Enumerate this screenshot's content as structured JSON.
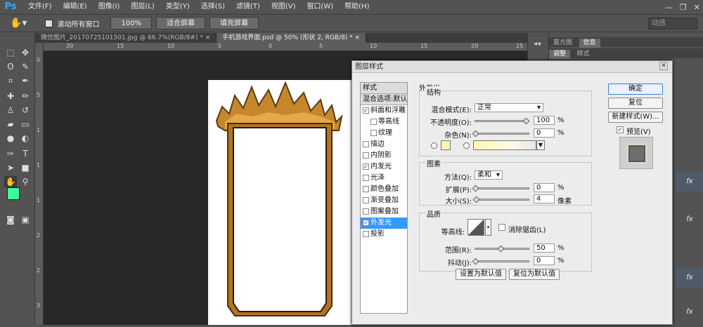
{
  "app": {
    "logo": "Ps"
  },
  "menu": [
    "文件(F)",
    "编辑(E)",
    "图像(I)",
    "图层(L)",
    "类型(Y)",
    "选择(S)",
    "滤镜(T)",
    "视图(V)",
    "窗口(W)",
    "帮助(H)"
  ],
  "window_controls": {
    "minimize": "—",
    "restore": "❐",
    "close": "✕"
  },
  "options_bar": {
    "scroll_all_label": "滚动所有窗口",
    "zoom_100": "100%",
    "fit_screen": "适合屏幕",
    "fill_screen": "填充屏幕",
    "workspace": "动感"
  },
  "tabs": [
    {
      "label": "微信图片_20170725101501.jpg @ 66.7%(RGB/8#) *  ×"
    },
    {
      "label": "手机游戏界面.psd @ 50% (形状 2, RGB/8) *  ×"
    }
  ],
  "ruler_top_ticks": [
    "20",
    "15",
    "10",
    "5",
    "0",
    "5",
    "10",
    "15",
    "20",
    "25"
  ],
  "ruler_left_ticks": [
    "0",
    "5",
    "1",
    "1",
    "1",
    "2",
    "2",
    "3"
  ],
  "right_panel": {
    "tabs_top": [
      "直方图",
      "信息"
    ],
    "tabs_bottom": [
      "调整",
      "样式"
    ],
    "fx_label": "fx"
  },
  "dialog": {
    "title": "图层样式",
    "close": "✕",
    "style_list": [
      {
        "label": "样式",
        "kind": "hdr"
      },
      {
        "label": "混合选项:默认",
        "kind": "hdr"
      },
      {
        "label": "斜面和浮雕",
        "checked": true
      },
      {
        "label": "等高线",
        "checked": false,
        "indent": true
      },
      {
        "label": "纹理",
        "checked": false,
        "indent": true
      },
      {
        "label": "描边",
        "checked": false
      },
      {
        "label": "内阴影",
        "checked": false
      },
      {
        "label": "内发光",
        "checked": true
      },
      {
        "label": "光泽",
        "checked": false
      },
      {
        "label": "颜色叠加",
        "checked": false
      },
      {
        "label": "渐变叠加",
        "checked": false
      },
      {
        "label": "图案叠加",
        "checked": false
      },
      {
        "label": "外发光",
        "checked": true,
        "selected": true
      },
      {
        "label": "投影",
        "checked": false
      }
    ],
    "section_title": "外发光",
    "structure": {
      "title": "结构",
      "blend_label": "混合模式(E):",
      "blend_value": "正常",
      "opacity_label": "不透明度(O):",
      "opacity_value": "100",
      "opacity_unit": "%",
      "opacity_fraction": 1.0,
      "noise_label": "杂色(N):",
      "noise_value": "0",
      "noise_unit": "%",
      "noise_fraction": 0.0,
      "color_swatch": "#fff5b0"
    },
    "elements": {
      "title": "图素",
      "technique_label": "方法(Q):",
      "technique_value": "柔和",
      "spread_label": "扩展(P):",
      "spread_value": "0",
      "spread_unit": "%",
      "spread_fraction": 0.0,
      "size_label": "大小(S):",
      "size_value": "4",
      "size_unit": "像素",
      "size_fraction": 0.02
    },
    "quality": {
      "title": "品质",
      "contour_label": "等高线:",
      "antialias_label": "消除锯齿(L)",
      "range_label": "范围(R):",
      "range_value": "50",
      "range_unit": "%",
      "range_fraction": 0.5,
      "jitter_label": "抖动(J):",
      "jitter_value": "0",
      "jitter_unit": "%",
      "jitter_fraction": 0.0
    },
    "make_default": "设置为默认值",
    "reset_default": "复位为默认值",
    "buttons": {
      "ok": "确定",
      "reset": "复位",
      "new_style": "新建样式(W)...",
      "preview": "预览(V)"
    }
  }
}
